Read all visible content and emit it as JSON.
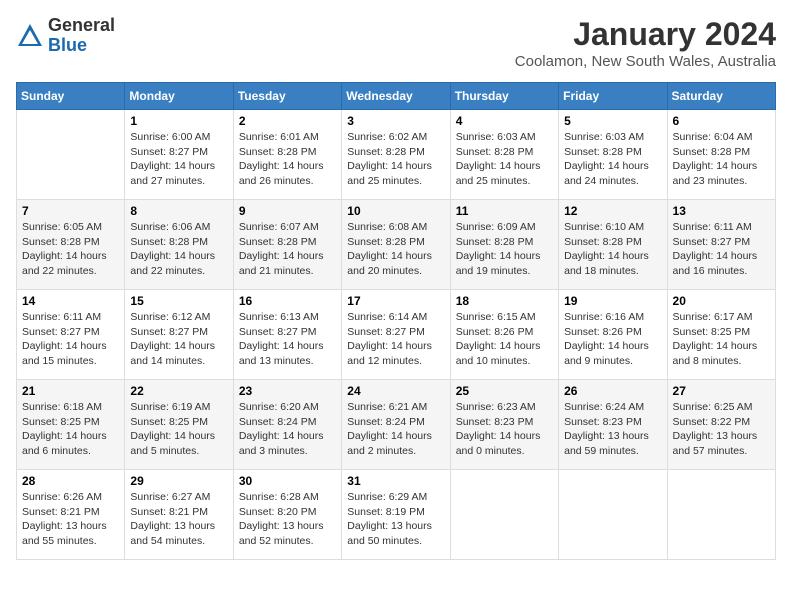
{
  "logo": {
    "general": "General",
    "blue": "Blue"
  },
  "title": "January 2024",
  "subtitle": "Coolamon, New South Wales, Australia",
  "days_of_week": [
    "Sunday",
    "Monday",
    "Tuesday",
    "Wednesday",
    "Thursday",
    "Friday",
    "Saturday"
  ],
  "weeks": [
    [
      {
        "num": "",
        "info": ""
      },
      {
        "num": "1",
        "info": "Sunrise: 6:00 AM\nSunset: 8:27 PM\nDaylight: 14 hours\nand 27 minutes."
      },
      {
        "num": "2",
        "info": "Sunrise: 6:01 AM\nSunset: 8:28 PM\nDaylight: 14 hours\nand 26 minutes."
      },
      {
        "num": "3",
        "info": "Sunrise: 6:02 AM\nSunset: 8:28 PM\nDaylight: 14 hours\nand 25 minutes."
      },
      {
        "num": "4",
        "info": "Sunrise: 6:03 AM\nSunset: 8:28 PM\nDaylight: 14 hours\nand 25 minutes."
      },
      {
        "num": "5",
        "info": "Sunrise: 6:03 AM\nSunset: 8:28 PM\nDaylight: 14 hours\nand 24 minutes."
      },
      {
        "num": "6",
        "info": "Sunrise: 6:04 AM\nSunset: 8:28 PM\nDaylight: 14 hours\nand 23 minutes."
      }
    ],
    [
      {
        "num": "7",
        "info": "Sunrise: 6:05 AM\nSunset: 8:28 PM\nDaylight: 14 hours\nand 22 minutes."
      },
      {
        "num": "8",
        "info": "Sunrise: 6:06 AM\nSunset: 8:28 PM\nDaylight: 14 hours\nand 22 minutes."
      },
      {
        "num": "9",
        "info": "Sunrise: 6:07 AM\nSunset: 8:28 PM\nDaylight: 14 hours\nand 21 minutes."
      },
      {
        "num": "10",
        "info": "Sunrise: 6:08 AM\nSunset: 8:28 PM\nDaylight: 14 hours\nand 20 minutes."
      },
      {
        "num": "11",
        "info": "Sunrise: 6:09 AM\nSunset: 8:28 PM\nDaylight: 14 hours\nand 19 minutes."
      },
      {
        "num": "12",
        "info": "Sunrise: 6:10 AM\nSunset: 8:28 PM\nDaylight: 14 hours\nand 18 minutes."
      },
      {
        "num": "13",
        "info": "Sunrise: 6:11 AM\nSunset: 8:27 PM\nDaylight: 14 hours\nand 16 minutes."
      }
    ],
    [
      {
        "num": "14",
        "info": "Sunrise: 6:11 AM\nSunset: 8:27 PM\nDaylight: 14 hours\nand 15 minutes."
      },
      {
        "num": "15",
        "info": "Sunrise: 6:12 AM\nSunset: 8:27 PM\nDaylight: 14 hours\nand 14 minutes."
      },
      {
        "num": "16",
        "info": "Sunrise: 6:13 AM\nSunset: 8:27 PM\nDaylight: 14 hours\nand 13 minutes."
      },
      {
        "num": "17",
        "info": "Sunrise: 6:14 AM\nSunset: 8:27 PM\nDaylight: 14 hours\nand 12 minutes."
      },
      {
        "num": "18",
        "info": "Sunrise: 6:15 AM\nSunset: 8:26 PM\nDaylight: 14 hours\nand 10 minutes."
      },
      {
        "num": "19",
        "info": "Sunrise: 6:16 AM\nSunset: 8:26 PM\nDaylight: 14 hours\nand 9 minutes."
      },
      {
        "num": "20",
        "info": "Sunrise: 6:17 AM\nSunset: 8:25 PM\nDaylight: 14 hours\nand 8 minutes."
      }
    ],
    [
      {
        "num": "21",
        "info": "Sunrise: 6:18 AM\nSunset: 8:25 PM\nDaylight: 14 hours\nand 6 minutes."
      },
      {
        "num": "22",
        "info": "Sunrise: 6:19 AM\nSunset: 8:25 PM\nDaylight: 14 hours\nand 5 minutes."
      },
      {
        "num": "23",
        "info": "Sunrise: 6:20 AM\nSunset: 8:24 PM\nDaylight: 14 hours\nand 3 minutes."
      },
      {
        "num": "24",
        "info": "Sunrise: 6:21 AM\nSunset: 8:24 PM\nDaylight: 14 hours\nand 2 minutes."
      },
      {
        "num": "25",
        "info": "Sunrise: 6:23 AM\nSunset: 8:23 PM\nDaylight: 14 hours\nand 0 minutes."
      },
      {
        "num": "26",
        "info": "Sunrise: 6:24 AM\nSunset: 8:23 PM\nDaylight: 13 hours\nand 59 minutes."
      },
      {
        "num": "27",
        "info": "Sunrise: 6:25 AM\nSunset: 8:22 PM\nDaylight: 13 hours\nand 57 minutes."
      }
    ],
    [
      {
        "num": "28",
        "info": "Sunrise: 6:26 AM\nSunset: 8:21 PM\nDaylight: 13 hours\nand 55 minutes."
      },
      {
        "num": "29",
        "info": "Sunrise: 6:27 AM\nSunset: 8:21 PM\nDaylight: 13 hours\nand 54 minutes."
      },
      {
        "num": "30",
        "info": "Sunrise: 6:28 AM\nSunset: 8:20 PM\nDaylight: 13 hours\nand 52 minutes."
      },
      {
        "num": "31",
        "info": "Sunrise: 6:29 AM\nSunset: 8:19 PM\nDaylight: 13 hours\nand 50 minutes."
      },
      {
        "num": "",
        "info": ""
      },
      {
        "num": "",
        "info": ""
      },
      {
        "num": "",
        "info": ""
      }
    ]
  ]
}
